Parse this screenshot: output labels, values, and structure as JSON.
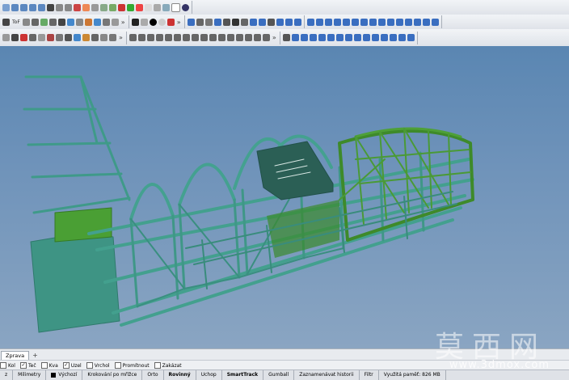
{
  "toolbar": {
    "row1_label": "",
    "row2_label": "ToF",
    "overflow": "»"
  },
  "colors": {
    "viewport_top": "#5a86b2",
    "viewport_bottom": "#8aa5c2",
    "frame_teal": "#4a9a8a",
    "frame_green": "#3c8a2c"
  },
  "tabs": {
    "active": "Zprava",
    "add": "+"
  },
  "snaps": [
    {
      "label": "Kol",
      "checked": false
    },
    {
      "label": "Teč",
      "checked": true
    },
    {
      "label": "Kva",
      "checked": false
    },
    {
      "label": "Uzel",
      "checked": true
    },
    {
      "label": "Vrchol",
      "checked": false
    },
    {
      "label": "Promítnout",
      "checked": false
    },
    {
      "label": "Zakázat",
      "checked": false
    }
  ],
  "status": {
    "z": "z",
    "units": "Milimetry",
    "layer": "Výchozí",
    "grid": "Krokování po mřížce",
    "ortho": "Orto",
    "planar": "Rovinný",
    "osnap": "Uchop",
    "smarttrack": "SmartTrack",
    "gumball": "Gumball",
    "history": "Zaznamenávat historii",
    "filter": "Filtr",
    "memory": "Využitá paměť: 826 MB"
  },
  "watermark": {
    "big": "莫西网",
    "small": "www.3dmox.com"
  }
}
